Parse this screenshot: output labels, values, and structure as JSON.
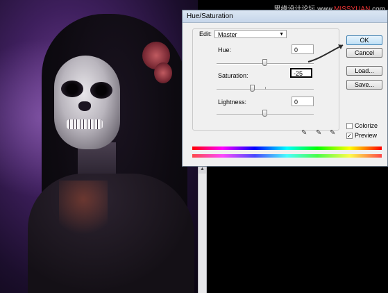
{
  "dialog": {
    "title": "Hue/Saturation",
    "edit_label": "Edit:",
    "edit_value": "Master",
    "hue": {
      "label": "Hue:",
      "value": "0",
      "level": 0.5
    },
    "saturation": {
      "label": "Saturation:",
      "value": "-25",
      "level": 0.375
    },
    "lightness": {
      "label": "Lightness:",
      "value": "0",
      "level": 0.5
    },
    "buttons": {
      "ok": "OK",
      "cancel": "Cancel",
      "load": "Load...",
      "save": "Save..."
    },
    "colorize": {
      "label": "Colorize",
      "checked": false
    },
    "preview": {
      "label": "Preview",
      "checked": true,
      "mark": "✓"
    },
    "icons": [
      "eyedropper-icon",
      "eyedropper-plus-icon",
      "eyedropper-minus-icon"
    ]
  },
  "watermark": {
    "text_cn": "思缘设计论坛",
    "text_url_a": "www.",
    "text_url_b": "MISSYUAN",
    "text_url_c": ".com"
  },
  "colors": {
    "accent_button": "#3c7fb1",
    "annotation_arrow": "#2b2b2b"
  }
}
